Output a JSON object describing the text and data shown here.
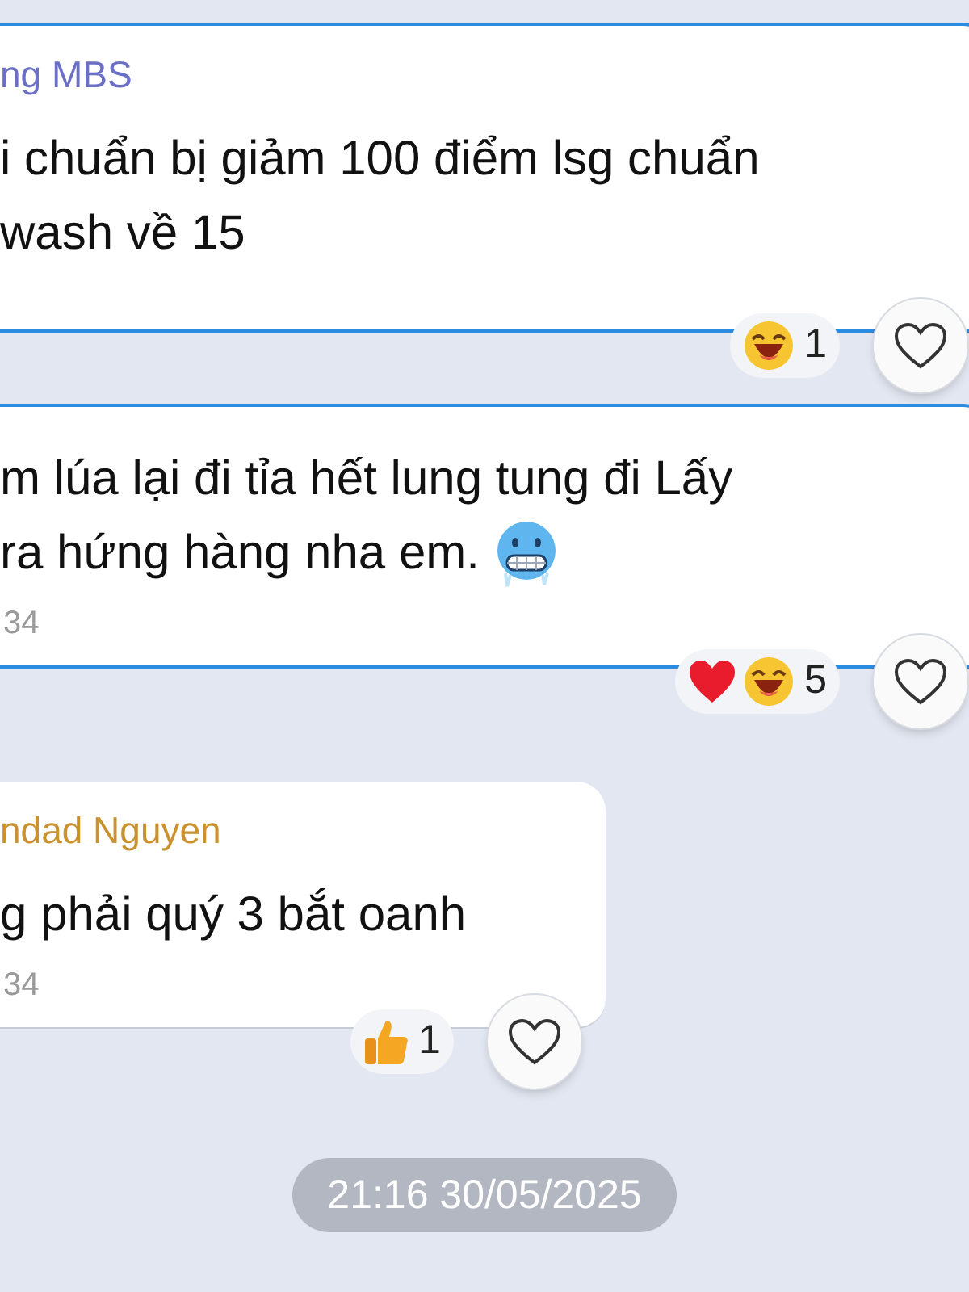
{
  "messages": [
    {
      "sender": "ng MBS",
      "color": "#6b6fc6",
      "highlighted": true,
      "lines": [
        "i chuẩn bị giảm 100 điểm lsg chuẩn",
        "wash về 15"
      ],
      "reactions": [
        {
          "kind": "laugh"
        }
      ],
      "reaction_count": "1",
      "wide": true
    },
    {
      "highlighted": true,
      "lines": [
        "m lúa lại đi tỉa hết lung tung đi  Lấy",
        "ra hứng hàng nha em."
      ],
      "trailing_emoji": {
        "kind": "cold"
      },
      "time": "34",
      "reactions": [
        {
          "kind": "heart"
        },
        {
          "kind": "laugh"
        }
      ],
      "reaction_count": "5",
      "wide": true
    },
    {
      "sender": "ndad Nguyen",
      "color": "#c9922f",
      "highlighted": false,
      "lines": [
        "g phải quý 3 bắt oanh"
      ],
      "time": "34",
      "reactions": [
        {
          "kind": "thumb"
        }
      ],
      "reaction_count": "1",
      "wide": false
    }
  ],
  "timestamp": "21:16 30/05/2025"
}
